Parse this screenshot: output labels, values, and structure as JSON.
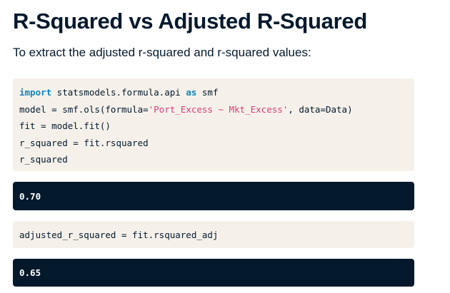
{
  "title": "R-Squared vs Adjusted R-Squared",
  "subtitle": "To extract the adjusted r-squared and r-squared values:",
  "code1": {
    "l1_kw1": "import",
    "l1_mid": " statsmodels.formula.api ",
    "l1_kw2": "as",
    "l1_end": " smf",
    "l2_a": "model = smf.ols(formula=",
    "l2_str": "'Port_Excess ~ Mkt_Excess'",
    "l2_b": ", data=Data)",
    "l3": "fit = model.fit()",
    "l4": "r_squared = fit.rsquared",
    "l5": "r_squared"
  },
  "output1": "0.70",
  "code2": "adjusted_r_squared = fit.rsquared_adj",
  "output2": "0.65"
}
